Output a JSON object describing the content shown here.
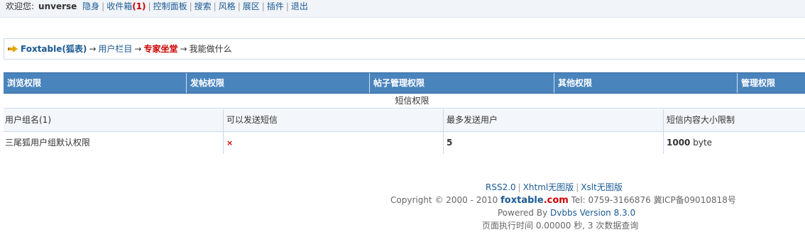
{
  "topbar": {
    "welcome": "欢迎您:",
    "username": "unverse",
    "links": [
      "隐身",
      "收件箱",
      "控制面板",
      "搜索",
      "风格",
      "展区",
      "插件",
      "退出"
    ],
    "inbox_count": "(1)"
  },
  "breadcrumb": {
    "forum": "Foxtable(狐表)",
    "section": "用户栏目",
    "subsection": "专家坐堂",
    "current": "我能做什么",
    "sep": "→"
  },
  "tabs": [
    "浏览权限",
    "发帖权限",
    "帖子管理权限",
    "其他权限",
    "管理权限"
  ],
  "sms": {
    "title": "短信权限",
    "headers": [
      "用户组名(1)",
      "可以发送短信",
      "最多发送用户",
      "短信内容大小限制"
    ],
    "row": {
      "group": "三尾狐用户组默认权限",
      "can_send": "×",
      "max_users": "5",
      "size_value": "1000",
      "size_unit": "byte"
    }
  },
  "footer": {
    "links": [
      "RSS2.0",
      "Xhtml无图版",
      "Xslt无图版"
    ],
    "copyright_prefix": "Copyright © 2000 - 2010",
    "brand_name": "foxtable",
    "brand_tld": ".com",
    "tel": "Tel: 0759-3166876 冀ICP备09010818号",
    "powered_prefix": "Powered By",
    "powered_link": "Dvbbs Version 8.3.0",
    "exec_time": "页面执行时间 0.00000 秒, 3 次数据查询"
  },
  "colors": {
    "tab_bar": "#4a84bd",
    "link": "#1b5a93",
    "accent_red": "#cc0000"
  }
}
